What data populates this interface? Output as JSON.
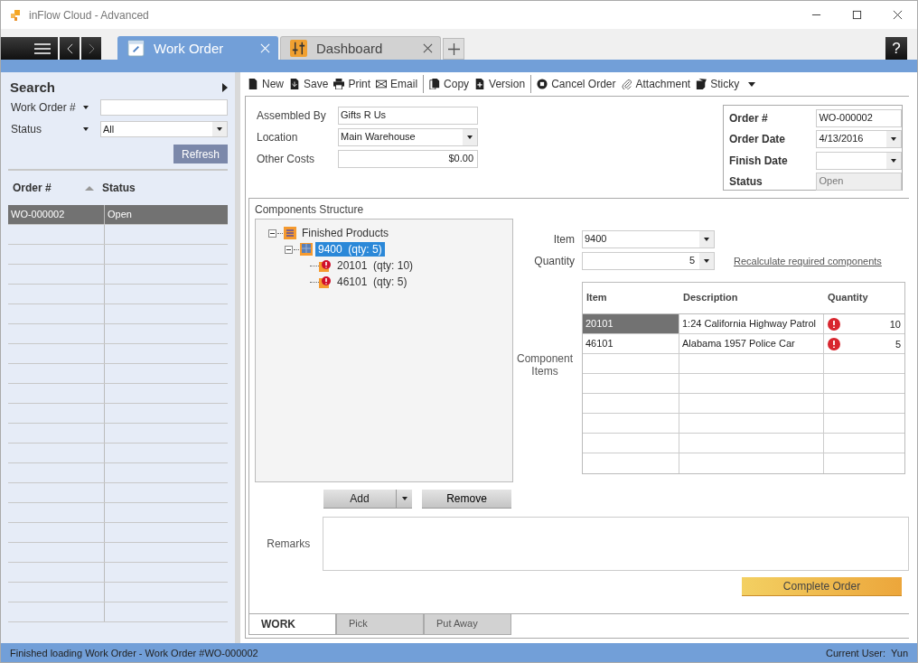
{
  "window": {
    "title": "inFlow Cloud - Advanced"
  },
  "tabs": [
    {
      "label": "Work Order",
      "kind": "form",
      "selected": true
    },
    {
      "label": "Dashboard",
      "kind": "dashboard",
      "selected": false
    }
  ],
  "help_button": "?",
  "sidebar": {
    "title": "Search",
    "filters": [
      {
        "label": "Work Order #",
        "kind": "text"
      },
      {
        "label": "Status",
        "kind": "dropdown",
        "value": "All"
      }
    ],
    "refresh_button": "Refresh",
    "list": {
      "columns": [
        "Order #",
        "Status"
      ],
      "rows": [
        {
          "order": "WO-000002",
          "status": "Open",
          "selected": true
        }
      ]
    }
  },
  "toolbar": [
    {
      "label": "New",
      "kind": "new",
      "separator_before": false,
      "dropdown": false
    },
    {
      "label": "Save",
      "kind": "save",
      "separator_before": false,
      "dropdown": false
    },
    {
      "label": "Print",
      "kind": "print",
      "separator_before": false,
      "dropdown": false
    },
    {
      "label": "Email",
      "kind": "email",
      "separator_before": false,
      "dropdown": false
    },
    {
      "label": "Copy",
      "kind": "copy",
      "separator_before": true,
      "dropdown": false
    },
    {
      "label": "Version",
      "kind": "version",
      "separator_before": false,
      "dropdown": false
    },
    {
      "label": "Cancel Order",
      "kind": "cancel",
      "separator_before": true,
      "dropdown": false
    },
    {
      "label": "Attachment",
      "kind": "attachment",
      "separator_before": false,
      "dropdown": false
    },
    {
      "label": "Sticky",
      "kind": "sticky",
      "separator_before": false,
      "dropdown": true
    }
  ],
  "fields": [
    {
      "label": "Assembled By",
      "value": "Gifts R Us",
      "kind": "text"
    },
    {
      "label": "Location",
      "value": "Main Warehouse",
      "kind": "dropdown"
    },
    {
      "label": "Other Costs",
      "value": "$0.00",
      "kind": "amount"
    }
  ],
  "order_info": [
    {
      "label": "Order #",
      "value": "WO-000002",
      "kind": "text"
    },
    {
      "label": "Order Date",
      "value": "4/13/2016",
      "kind": "dropdown"
    },
    {
      "label": "Finish Date",
      "kind": "dropdown"
    },
    {
      "label": "Status",
      "value": "Open",
      "kind": "readonly"
    }
  ],
  "components": {
    "title": "Components Structure",
    "tree": [
      {
        "label": "Finished Products",
        "kind": "category",
        "expanded": true,
        "selected": false,
        "children": [
          {
            "label": "9400  (qty: 5)",
            "kind": "product",
            "expanded": true,
            "selected": true,
            "children": [
              {
                "label": "20101  (qty: 10)",
                "kind": "warning",
                "selected": false
              },
              {
                "label": "46101  (qty: 5)",
                "kind": "warning",
                "selected": false
              }
            ]
          }
        ]
      }
    ],
    "item_label": "Item",
    "item_value": "9400",
    "quantity_label": "Quantity",
    "quantity_value": "5",
    "recalculate_link": "Recalculate required components",
    "items_label": "Component Items",
    "table": {
      "columns": [
        "Item",
        "Description",
        "Quantity"
      ],
      "rows": [
        {
          "item": "20101",
          "description": "1:24 California Highway Patrol",
          "quantity": "10",
          "warning": true,
          "selected": true
        },
        {
          "item": "46101",
          "description": "Alabama 1957 Police Car",
          "quantity": "5",
          "warning": true,
          "selected": false
        }
      ]
    },
    "add_button": "Add",
    "remove_button": "Remove"
  },
  "remarks": {
    "label": "Remarks"
  },
  "complete_button": "Complete Order",
  "bottom_tabs": [
    {
      "label": "WORK",
      "selected": true
    },
    {
      "label": "Pick",
      "selected": false
    },
    {
      "label": "Put Away",
      "selected": false
    }
  ],
  "status_bar": {
    "message": "Finished loading Work Order - Work Order #WO-000002",
    "user_label": "Current User:",
    "user": "Yun"
  }
}
